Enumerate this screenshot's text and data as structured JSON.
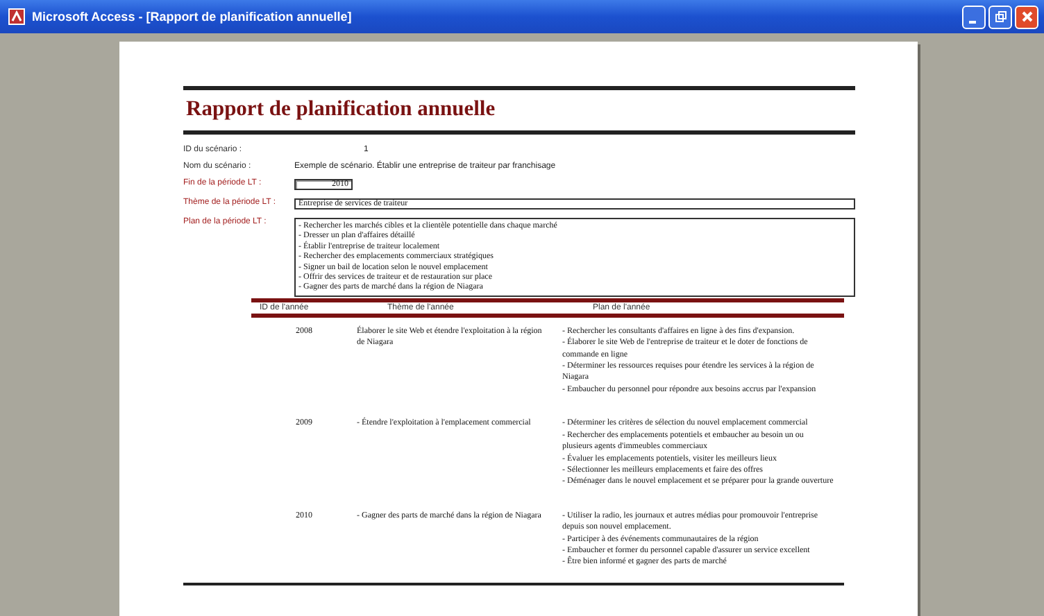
{
  "window": {
    "title": "Microsoft Access - [Rapport de planification annuelle]"
  },
  "report": {
    "title": "Rapport de planification annuelle",
    "fields": [
      {
        "kind": "plain",
        "label": "ID du scénario :",
        "value": "1"
      },
      {
        "kind": "plain",
        "label": "Nom du scénario :",
        "value": "Exemple de scénario. Établir une entreprise de traiteur par franchisage"
      },
      {
        "kind": "number",
        "label": "Fin de la période LT :",
        "value": "2010"
      },
      {
        "kind": "boxed",
        "label": "Thème de la période LT :",
        "value": "Entreprise de services de traiteur"
      },
      {
        "kind": "list",
        "label": "Plan de la période LT :",
        "lines": [
          "- Rechercher les marchés cibles et la clientèle potentielle dans chaque marché",
          "- Dresser un plan d'affaires détaillé",
          "- Établir l'entreprise de traiteur localement",
          "- Rechercher des emplacements commerciaux stratégiques",
          "- Signer un bail de location selon le nouvel emplacement",
          "- Offrir des services de traiteur et de restauration sur place",
          "- Gagner des parts de marché dans la région de Niagara"
        ]
      }
    ],
    "table": {
      "columns": [
        "ID de l'année",
        "Thème de l'année",
        "Plan de l'année"
      ],
      "rows": [
        {
          "year": "2008",
          "theme": "Élaborer le site Web et étendre l'exploitation à la région de Niagara",
          "plan": [
            "- Rechercher les consultants d'affaires en ligne à des fins d'expansion.",
            "- Élaborer le site Web de l'entreprise de traiteur et le doter de fonctions de commande en ligne",
            "- Déterminer les ressources requises pour étendre les services à la région de Niagara",
            "- Embaucher du personnel pour répondre aux besoins accrus par l'expansion"
          ]
        },
        {
          "year": "2009",
          "theme": "- Étendre l'exploitation à l'emplacement commercial",
          "plan": [
            "- Déterminer les critères de sélection du nouvel emplacement commercial",
            "- Rechercher des emplacements potentiels et embaucher au besoin un ou plusieurs agents d'immeubles commerciaux",
            "- Évaluer les emplacements potentiels, visiter les meilleurs lieux",
            "- Sélectionner les meilleurs emplacements et faire des offres",
            "- Déménager dans le nouvel emplacement et se préparer pour la grande ouverture"
          ]
        },
        {
          "year": "2010",
          "theme": "- Gagner des parts de marché dans la région de Niagara",
          "plan": [
            "- Utiliser la radio, les journaux et autres médias pour promouvoir l'entreprise depuis son nouvel emplacement.",
            "- Participer à des événements communautaires de la région",
            "- Embaucher et former du personnel capable d'assurer un service excellent",
            "- Être bien informé et gagner des parts de marché"
          ]
        }
      ]
    }
  }
}
